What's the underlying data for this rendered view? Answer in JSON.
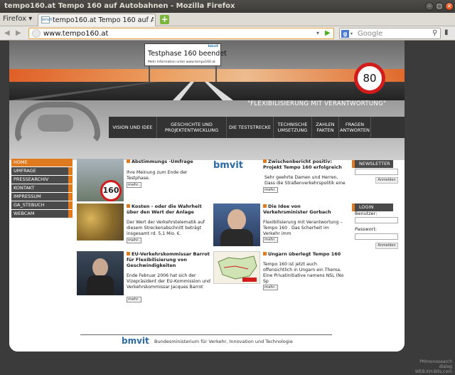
{
  "window": {
    "title": "tempo160.at Tempo 160 auf Autobahnen - Mozilla Firefox",
    "buttons": [
      "–",
      "□",
      "×"
    ]
  },
  "browser": {
    "menu_label": "Firefox ▾",
    "tab_title": "tempo160.at Tempo 160 auf A...",
    "tab_favicon_text": "bmvit",
    "newtab_label": "+",
    "url": "www.tempo160.at",
    "search_placeholder": "Google"
  },
  "header": {
    "gantry_title": "Testphase 160 beendet",
    "gantry_sub": "Mehr Information unter www.tempo160.at",
    "gantry_logo": "bmvit",
    "speed_limit": "80",
    "slogan": "\"FLEXIBILISIERUNG MIT VERANTWORTUNG\""
  },
  "topnav": [
    {
      "label": "VISION UND IDEE"
    },
    {
      "label": "GESCHICHTE UND PROJEKTENTWICKLUNG"
    },
    {
      "label": "DIE TESTSTRECKE"
    },
    {
      "label": "TECHNISCHE UMSETZUNG"
    },
    {
      "label": "ZAHLEN FAKTEN"
    },
    {
      "label": "FRAGEN ANTWORTEN"
    }
  ],
  "leftmenu": [
    {
      "label": "HOME"
    },
    {
      "label": "UMFRAGE"
    },
    {
      "label": "PRESSEARCHIV"
    },
    {
      "label": "KONTAKT"
    },
    {
      "label": "IMPRESSUM"
    },
    {
      "label": "GA_STEBUCH"
    },
    {
      "label": "WEBCAM"
    }
  ],
  "articles": {
    "a1": {
      "title": "Abstimmungs -Umfrage",
      "text": "Ihre Meinung zum Ende der Testphase.",
      "more": "mehr..",
      "thumb_text": "160"
    },
    "a2": {
      "title": "Kosten - oder die Wahrheit über den Wert der Anlage",
      "text": "Der Wert der Verkehrstelematik auf diesem Streckenabschnitt beträgt insgesamt rd. 5,1 Mio. €.",
      "more": "mehr.."
    },
    "a3": {
      "title": "EU-Verkehrskommissar Barrot für Flexibilisierung von Geschwindigkeiten",
      "text": "Ende Februar 2006 hat sich der Vizepräsident der EU-Kommission und Verkehrskommissar Jacques Barrot",
      "more": "mehr.."
    },
    "a4": {
      "title": "Zwischenbericht positiv: Projekt Tempo 160 erfolgreich",
      "text": "Sehr geehrte Damen und Herren, Dass die Straßenverkehrspolitik eine",
      "more": "mehr..",
      "thumb_text": "bmvit"
    },
    "a5": {
      "title": "Die Idee von Verkehrsminister Gorbach",
      "text": "Flexibilisierung mit Verantwortung – Tempo 160 . Das Scherheit im Verkehr imm",
      "more": "mehr.."
    },
    "a6": {
      "title": "Ungarn überlegt Tempo 160",
      "text": "Tempo 160 ist jetzt auch offensichtlich in Ungarn ein Thema. Eine Privatinitiative namens NSL (No Sp",
      "more": "mehr.."
    }
  },
  "newsletter": {
    "heading": "NEWSLETTER",
    "button": "Anmelden"
  },
  "login": {
    "heading": "LOGIN",
    "user_label": "Benutzer:",
    "pass_label": "Passwort:",
    "button": "Anmelden"
  },
  "footer": {
    "text": "Bundesministerium für Verkehr, Innovation und Technologie",
    "logo": "bmvit"
  },
  "watermark": {
    "line1": "PMmonosearch dialog",
    "line2": "WEB.KH-Bits.com"
  },
  "colors": {
    "accent": "#e07a1f",
    "menu_bg": "#4a4a4a",
    "sign_red": "#d21b1b"
  }
}
